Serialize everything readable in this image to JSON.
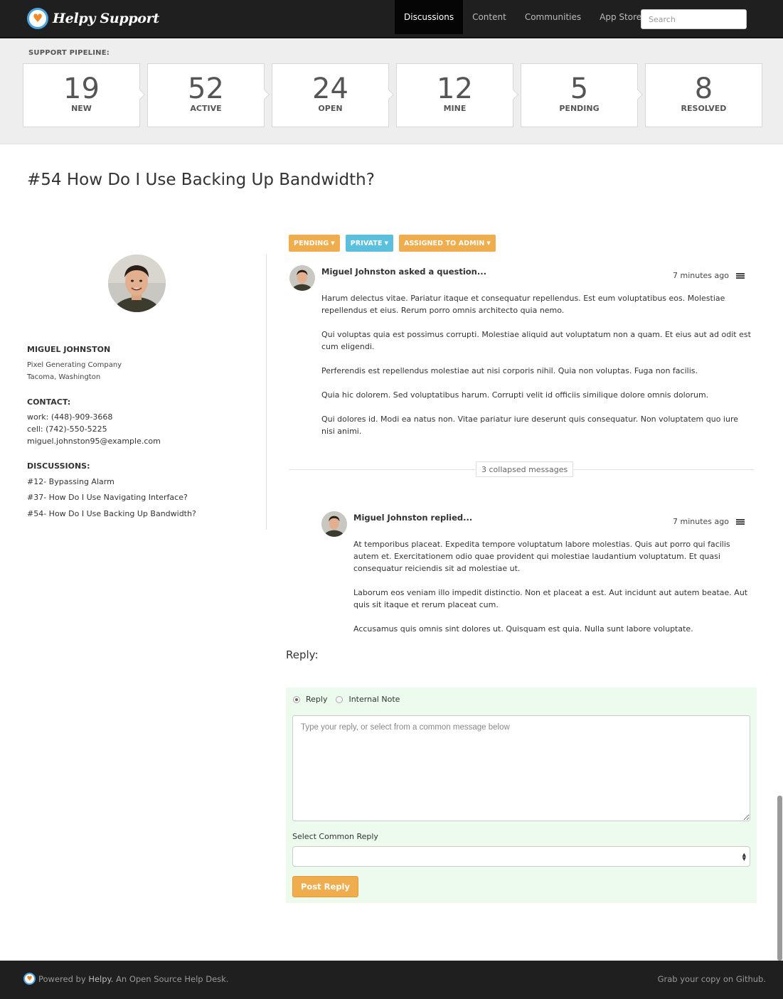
{
  "brand": {
    "name": "Helpy Support",
    "logo_icon": "heart-icon",
    "accent": "#4aa3df",
    "heart_color": "#f08a24"
  },
  "nav": {
    "items": [
      {
        "label": "Discussions",
        "active": true
      },
      {
        "label": "Content",
        "active": false
      },
      {
        "label": "Communities",
        "active": false
      },
      {
        "label": "App Store",
        "active": false
      }
    ],
    "search_placeholder": "Search"
  },
  "pipeline": {
    "label": "SUPPORT PIPELINE:",
    "stages": [
      {
        "count": "19",
        "label": "NEW"
      },
      {
        "count": "52",
        "label": "ACTIVE"
      },
      {
        "count": "24",
        "label": "OPEN"
      },
      {
        "count": "12",
        "label": "MINE"
      },
      {
        "count": "5",
        "label": "PENDING"
      },
      {
        "count": "8",
        "label": "RESOLVED"
      }
    ]
  },
  "ticket": {
    "title": "#54 How Do I Use Backing Up Bandwidth?"
  },
  "customer": {
    "name": "MIGUEL JOHNSTON",
    "company": "Pixel Generating Company",
    "location": "Tacoma, Washington",
    "contact_title": "CONTACT:",
    "work": "work: (448)-909-3668",
    "cell": "cell: (742)-550-5225",
    "email": "miguel.johnston95@example.com",
    "discussions_title": "DISCUSSIONS:",
    "discussions": [
      "#12- Bypassing Alarm",
      "#37- How Do I Use Navigating Interface?",
      "#54- How Do I Use Backing Up Bandwidth?"
    ]
  },
  "status_buttons": [
    {
      "label": "PENDING",
      "color": "#f0ad4e"
    },
    {
      "label": "PRIVATE",
      "color": "#5bc0de"
    },
    {
      "label": "ASSIGNED TO ADMIN",
      "color": "#f0ad4e"
    }
  ],
  "messages": [
    {
      "author": "Miguel Johnston asked a question...",
      "time": "7 minutes ago",
      "paragraphs": [
        "Harum delectus vitae. Pariatur itaque et consequatur repellendus. Est eum voluptatibus eos. Molestiae repellendus et eius. Rerum porro omnis architecto quia nemo.",
        "Qui voluptas quia est possimus corrupti. Molestiae aliquid aut voluptatum non a quam. Et eius aut ad odit est cum eligendi.",
        "Perferendis est repellendus molestiae aut nisi corporis nihil. Quia non voluptas. Fuga non facilis.",
        "Quia hic dolorem. Sed voluptatibus harum. Corrupti velit id officiis similique dolore omnis dolorum.",
        "Qui dolores id. Modi ea natus non. Vitae pariatur iure deserunt quis consequatur. Non voluptatem quo iure nisi animi."
      ]
    },
    {
      "author": "Miguel Johnston replied...",
      "time": "7 minutes ago",
      "paragraphs": [
        "At temporibus placeat. Expedita tempore voluptatum labore molestias. Quis aut porro qui facilis autem et. Exercitationem odio quae provident qui molestiae laudantium voluptatum. Et quasi consequatur reiciendis sit ad molestiae ut.",
        "Laborum eos veniam illo impedit distinctio. Non et placeat a est. Aut incidunt aut autem beatae. Aut quis sit itaque et rerum placeat cum.",
        "Accusamus quis omnis sint dolores ut. Quisquam est quia. Nulla sunt labore voluptate."
      ]
    }
  ],
  "collapsed": {
    "label": "3 collapsed messages"
  },
  "reply": {
    "heading": "Reply:",
    "option_reply": "Reply",
    "option_note": "Internal Note",
    "selected_option": "Reply",
    "placeholder": "Type your reply, or select from a common message below",
    "common_label": "Select Common Reply",
    "common_value": "",
    "post_label": "Post Reply",
    "panel_color": "#ecfbee"
  },
  "footer": {
    "powered_prefix": "Powered by",
    "powered_brand": "Helpy.",
    "powered_suffix": "An Open Source Help Desk.",
    "github": "Grab your copy on Github."
  }
}
